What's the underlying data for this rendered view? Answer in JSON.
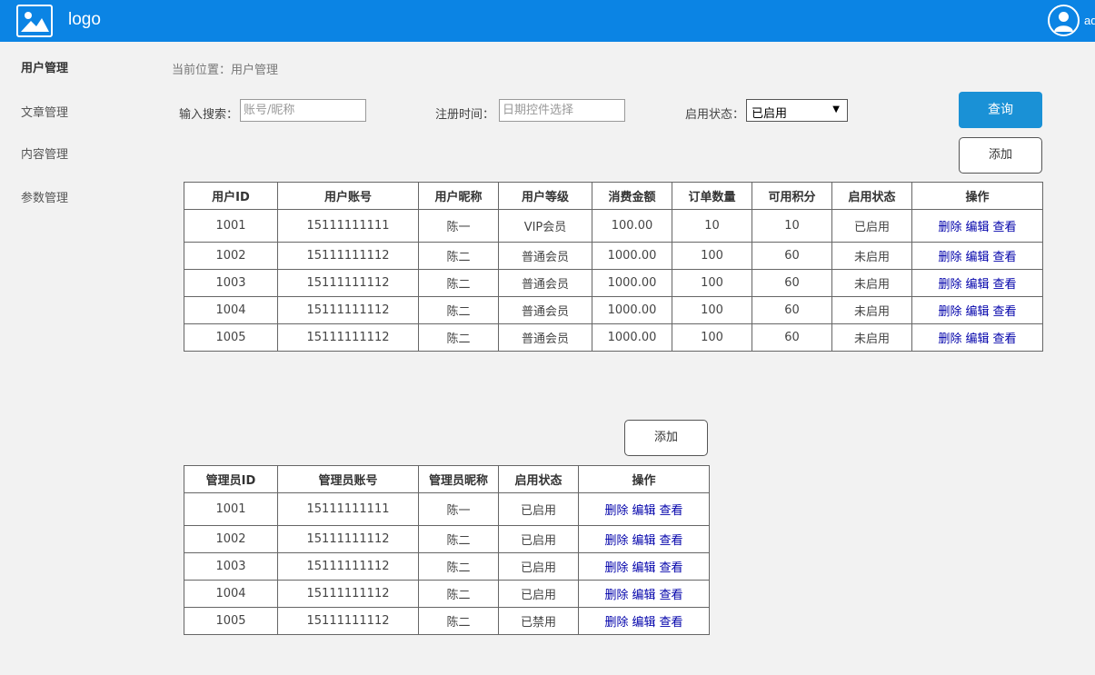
{
  "header": {
    "logo_text": "logo",
    "admin_name": "admin"
  },
  "sidebar": {
    "items": [
      {
        "label": "用户管理",
        "active": true
      },
      {
        "label": "文章管理",
        "active": false
      },
      {
        "label": "内容管理",
        "active": false
      },
      {
        "label": "参数管理",
        "active": false
      }
    ]
  },
  "breadcrumb": "当前位置：用户管理",
  "filters": {
    "search_label": "输入搜索：",
    "search_placeholder": "账号/昵称",
    "date_label": "注册时间：",
    "date_placeholder": "日期控件选择",
    "status_label": "启用状态：",
    "status_value": "已启用",
    "query_label": "查询",
    "add_label": "添加"
  },
  "user_table": {
    "columns": [
      "用户ID",
      "用户账号",
      "用户昵称",
      "用户等级",
      "消费金额",
      "订单数量",
      "可用积分",
      "启用状态",
      "操作"
    ],
    "rows": [
      {
        "id": "1001",
        "account": "15111111111",
        "nickname": "陈一",
        "level": "VIP会员",
        "amount": "100.00",
        "orders": "10",
        "points": "10",
        "status": "已启用"
      },
      {
        "id": "1002",
        "account": "15111111112",
        "nickname": "陈二",
        "level": "普通会员",
        "amount": "1000.00",
        "orders": "100",
        "points": "60",
        "status": "未启用"
      },
      {
        "id": "1003",
        "account": "15111111112",
        "nickname": "陈二",
        "level": "普通会员",
        "amount": "1000.00",
        "orders": "100",
        "points": "60",
        "status": "未启用"
      },
      {
        "id": "1004",
        "account": "15111111112",
        "nickname": "陈二",
        "level": "普通会员",
        "amount": "1000.00",
        "orders": "100",
        "points": "60",
        "status": "未启用"
      },
      {
        "id": "1005",
        "account": "15111111112",
        "nickname": "陈二",
        "level": "普通会员",
        "amount": "1000.00",
        "orders": "100",
        "points": "60",
        "status": "未启用"
      }
    ]
  },
  "admin_section": {
    "add_label": "添加"
  },
  "admin_table": {
    "columns": [
      "管理员ID",
      "管理员账号",
      "管理员昵称",
      "启用状态",
      "操作"
    ],
    "rows": [
      {
        "id": "1001",
        "account": "15111111111",
        "nickname": "陈一",
        "status": "已启用"
      },
      {
        "id": "1002",
        "account": "15111111112",
        "nickname": "陈二",
        "status": "已启用"
      },
      {
        "id": "1003",
        "account": "15111111112",
        "nickname": "陈二",
        "status": "已启用"
      },
      {
        "id": "1004",
        "account": "15111111112",
        "nickname": "陈二",
        "status": "已启用"
      },
      {
        "id": "1005",
        "account": "15111111112",
        "nickname": "陈二",
        "status": "已禁用"
      }
    ]
  },
  "actions": {
    "delete": "删除",
    "edit": "编辑",
    "view": "查看"
  },
  "colors": {
    "topbar": "#0b84e4",
    "query_button": "#1a91d6",
    "action_link": "#0000aa"
  }
}
